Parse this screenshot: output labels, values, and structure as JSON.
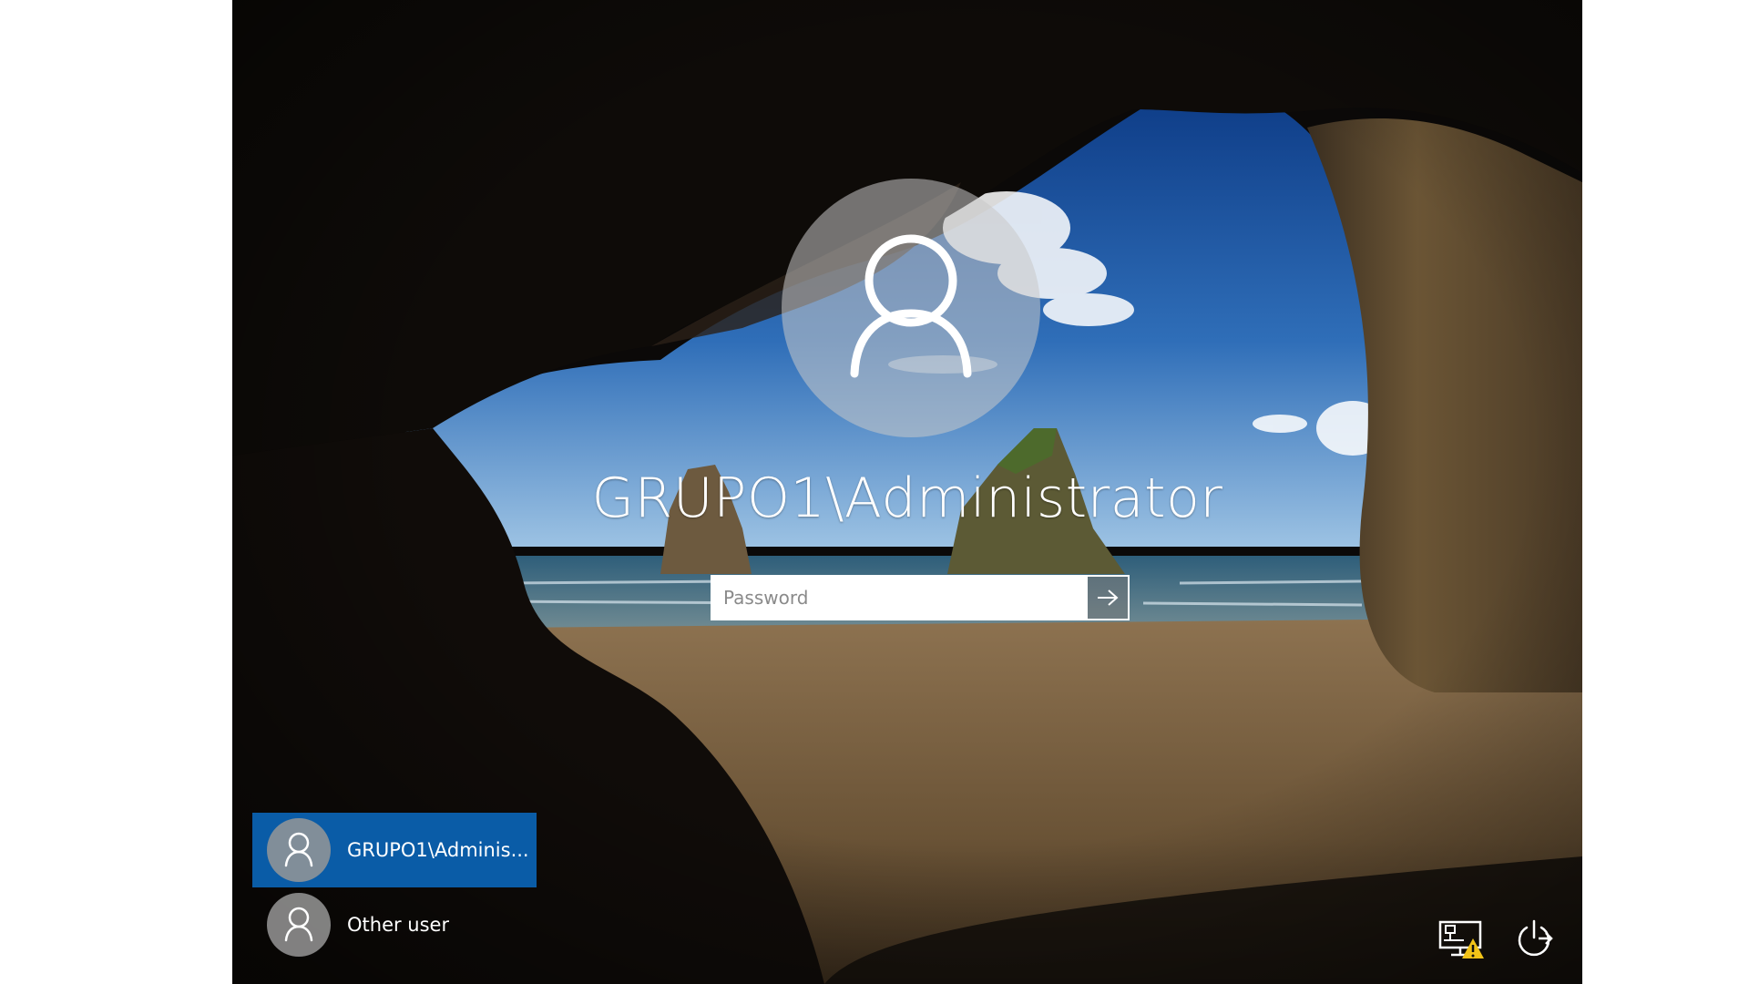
{
  "lockscreen": {
    "username": "GRUPO1\\Administrator",
    "password_placeholder": "Password",
    "submit_icon": "arrow-right-icon",
    "background": "cave-beach-photo"
  },
  "user_list": [
    {
      "label": "GRUPO1\\Adminis...",
      "selected": true,
      "icon": "user-avatar-icon"
    },
    {
      "label": "Other user",
      "selected": false,
      "icon": "user-avatar-icon"
    }
  ],
  "system_icons": [
    {
      "name": "network-warning-icon"
    },
    {
      "name": "power-icon"
    }
  ],
  "colors": {
    "selected_user": "#0a5ca7",
    "warning": "#f2c318"
  }
}
